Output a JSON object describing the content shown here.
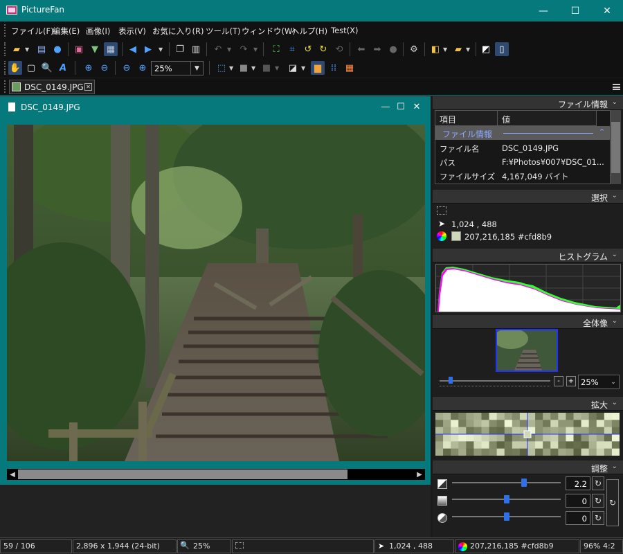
{
  "app": {
    "title": "PictureFan"
  },
  "window_controls": {
    "minimize": "—",
    "maximize": "☐",
    "close": "✕"
  },
  "menu": [
    "ファイル(F)",
    "編集(E)",
    "画像(I)",
    "表示(V)",
    "お気に入り(R)",
    "ツール(T)",
    "ウィンドウ(W)",
    "ヘルプ(H)",
    "Test(X)"
  ],
  "toolbar": {
    "zoom": {
      "value": "25%"
    }
  },
  "document_tab": {
    "label": "DSC_0149.JPG",
    "close": "✕"
  },
  "document_window": {
    "title": "DSC_0149.JPG"
  },
  "panels": {
    "file_info": {
      "title": "ファイル情報",
      "columns": [
        "項目",
        "値"
      ],
      "group": "ファイル情報",
      "rows": [
        {
          "key": "ファイル名",
          "value": "DSC_0149.JPG"
        },
        {
          "key": "パス",
          "value": "F:¥Photos¥007¥DSC_01..."
        },
        {
          "key": "ファイルサイズ",
          "value": "4,167,049 バイト"
        }
      ]
    },
    "selection": {
      "title": "選択",
      "position": "1,024 , 488",
      "color": "207,216,185 #cfd8b9",
      "swatch_color": "#cfd8b9"
    },
    "histogram": {
      "title": "ヒストグラム"
    },
    "overview": {
      "title": "全体像",
      "minus": "-",
      "plus": "+",
      "zoom": "25%",
      "slider_fraction": 0.1
    },
    "magnifier": {
      "title": "拡大"
    },
    "adjust": {
      "title": "調整",
      "rows": [
        {
          "value": "2.2",
          "fraction": 0.66
        },
        {
          "value": "0",
          "fraction": 0.5
        },
        {
          "value": "0",
          "fraction": 0.5
        }
      ]
    }
  },
  "status": {
    "index": "59 / 106",
    "dimensions": "2,896 x 1,944 (24-bit)",
    "zoom": "25%",
    "position": "1,024 , 488",
    "color": "207,216,185 #cfd8b9",
    "extra": "96% 4:2"
  },
  "colors": {
    "accent": "#06797d",
    "thumb_blue": "#2f6fe8",
    "histogram_magenta": "#ff00ff",
    "histogram_green": "#33ff33"
  }
}
